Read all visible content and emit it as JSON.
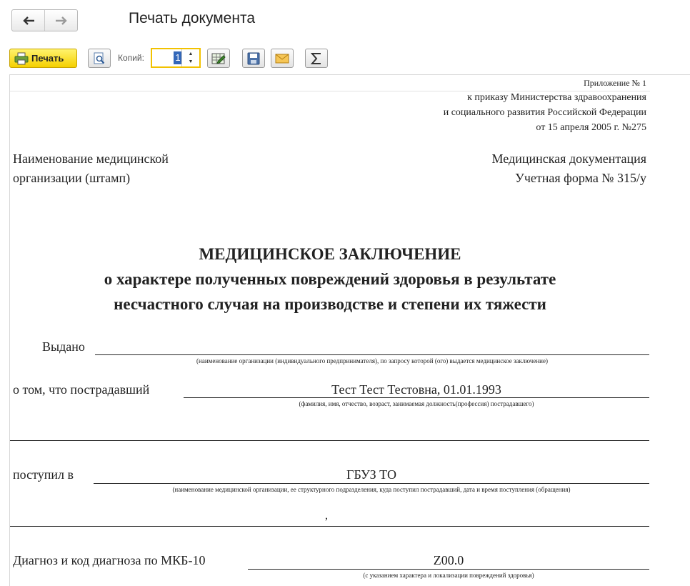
{
  "window": {
    "title": "Печать документа"
  },
  "toolbar": {
    "print_label": "Печать",
    "copies_label": "Копий:",
    "copies_value": "1"
  },
  "doc": {
    "appendix": "Приложение № 1",
    "order1": "к приказу Министерства здравоохранения",
    "order2": "и социального развития Российской Федерации",
    "order3": "от 15 апреля 2005 г. №275",
    "org1": "Наименование медицинской",
    "org2": "организации (штамп)",
    "medoc1": "Медицинская документация",
    "medoc2": "Учетная форма № 315/у",
    "heading1": "МЕДИЦИНСКОЕ ЗАКЛЮЧЕНИЕ",
    "heading2": "о характере полученных повреждений здоровья в результате",
    "heading3": "несчастного случая на производстве и степени их тяжести",
    "issued_label": "Выдано",
    "issued_hint": "(наименование организации (индивидуального предпринимателя), по запросу которой (ого) выдается медицинское заключение)",
    "victim_label": "о том, что пострадавший",
    "victim_value": "Тест Тест Тестовна, 01.01.1993",
    "victim_hint": "(фамилия, имя, отчество, возраст, занимаемая должность(профессия) пострадавшего)",
    "admitted_label": "поступил в",
    "admitted_value": "ГБУЗ ТО",
    "admitted_hint": "(наименование медицинской организации, ее структурного подразделения, куда поступил пострадавший, дата и время поступления (обращения)",
    "comma": ",",
    "diag_label": "Диагноз и код диагноза по МКБ-10",
    "diag_value": "Z00.0",
    "diag_hint": "(с указанием характера и локализации повреждений здоровья)"
  }
}
